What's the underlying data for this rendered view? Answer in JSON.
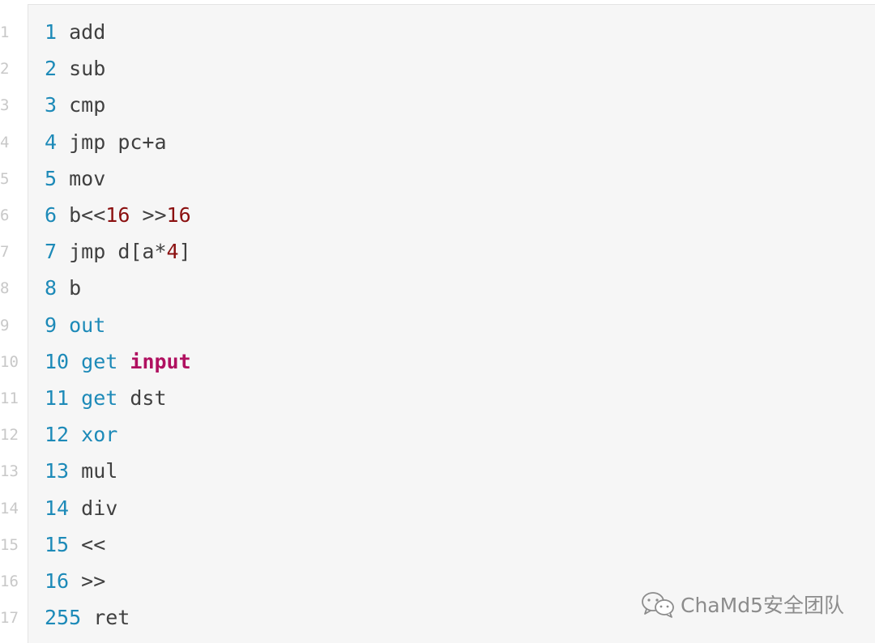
{
  "code": {
    "lines": [
      {
        "n": "1",
        "tokens": [
          {
            "t": "1",
            "c": "num"
          },
          {
            "t": " add",
            "c": "plain"
          }
        ]
      },
      {
        "n": "2",
        "tokens": [
          {
            "t": "2",
            "c": "num"
          },
          {
            "t": " sub",
            "c": "plain"
          }
        ]
      },
      {
        "n": "3",
        "tokens": [
          {
            "t": "3",
            "c": "num"
          },
          {
            "t": " cmp",
            "c": "plain"
          }
        ]
      },
      {
        "n": "4",
        "tokens": [
          {
            "t": "4",
            "c": "num"
          },
          {
            "t": " jmp pc+a",
            "c": "plain"
          }
        ]
      },
      {
        "n": "5",
        "tokens": [
          {
            "t": "5",
            "c": "num"
          },
          {
            "t": " mov",
            "c": "plain"
          }
        ]
      },
      {
        "n": "6",
        "tokens": [
          {
            "t": "6",
            "c": "num"
          },
          {
            "t": " b<<",
            "c": "plain"
          },
          {
            "t": "16",
            "c": "lit"
          },
          {
            "t": " >>",
            "c": "plain"
          },
          {
            "t": "16",
            "c": "lit"
          }
        ]
      },
      {
        "n": "7",
        "tokens": [
          {
            "t": "7",
            "c": "num"
          },
          {
            "t": " jmp d[a*",
            "c": "plain"
          },
          {
            "t": "4",
            "c": "lit"
          },
          {
            "t": "]",
            "c": "plain"
          }
        ]
      },
      {
        "n": "8",
        "tokens": [
          {
            "t": "8",
            "c": "num"
          },
          {
            "t": " b",
            "c": "plain"
          }
        ]
      },
      {
        "n": "9",
        "tokens": [
          {
            "t": "9",
            "c": "num"
          },
          {
            "t": " ",
            "c": "plain"
          },
          {
            "t": "out",
            "c": "kw"
          }
        ]
      },
      {
        "n": "10",
        "tokens": [
          {
            "t": "10",
            "c": "num"
          },
          {
            "t": " ",
            "c": "plain"
          },
          {
            "t": "get",
            "c": "kw"
          },
          {
            "t": " ",
            "c": "plain"
          },
          {
            "t": "input",
            "c": "builtin"
          }
        ]
      },
      {
        "n": "11",
        "tokens": [
          {
            "t": "11",
            "c": "num"
          },
          {
            "t": " ",
            "c": "plain"
          },
          {
            "t": "get",
            "c": "kw"
          },
          {
            "t": " dst",
            "c": "plain"
          }
        ]
      },
      {
        "n": "12",
        "tokens": [
          {
            "t": "12",
            "c": "num"
          },
          {
            "t": " ",
            "c": "plain"
          },
          {
            "t": "xor",
            "c": "kw"
          }
        ]
      },
      {
        "n": "13",
        "tokens": [
          {
            "t": "13",
            "c": "num"
          },
          {
            "t": " mul",
            "c": "plain"
          }
        ]
      },
      {
        "n": "14",
        "tokens": [
          {
            "t": "14",
            "c": "num"
          },
          {
            "t": " div",
            "c": "plain"
          }
        ]
      },
      {
        "n": "15",
        "tokens": [
          {
            "t": "15",
            "c": "num"
          },
          {
            "t": " <<",
            "c": "plain"
          }
        ]
      },
      {
        "n": "16",
        "tokens": [
          {
            "t": "16",
            "c": "num"
          },
          {
            "t": " >>",
            "c": "plain"
          }
        ]
      },
      {
        "n": "17",
        "tokens": [
          {
            "t": "255",
            "c": "num"
          },
          {
            "t": " ret",
            "c": "plain"
          }
        ]
      }
    ]
  },
  "watermark": {
    "icon": "wechat-icon",
    "text": "ChaMd5安全团队"
  },
  "colors": {
    "panel_bg": "#f6f6f6",
    "number": "#1d8ab8",
    "keyword": "#1d8ab8",
    "literal": "#8b1010",
    "builtin": "#b01060",
    "plain": "#404040",
    "line_number": "#c8c8c8"
  }
}
